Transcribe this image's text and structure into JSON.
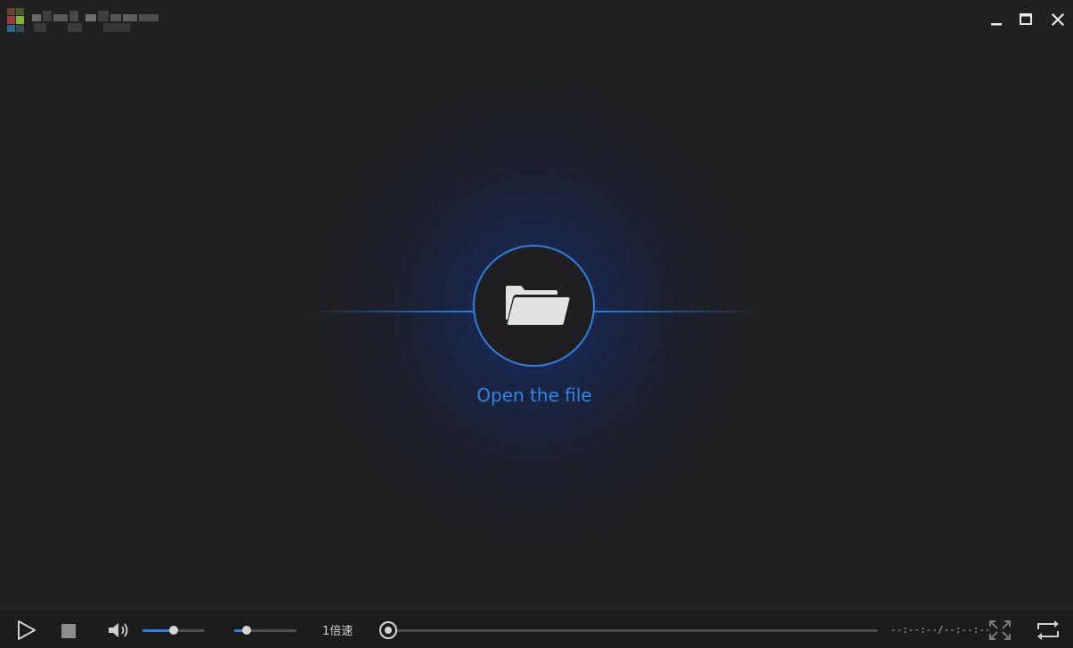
{
  "titlebar": {
    "logo_icon": "app-logo-icon",
    "title_text": "",
    "buttons": [
      {
        "name": "minimize",
        "icon": "minimize-icon"
      },
      {
        "name": "maximize",
        "icon": "maximize-icon"
      },
      {
        "name": "close",
        "icon": "close-icon"
      }
    ]
  },
  "stage": {
    "open_icon": "folder-open-icon",
    "open_label": "Open the file",
    "accent_color": "#2f86e6"
  },
  "controls": {
    "play_icon": "play-icon",
    "stop_icon": "stop-icon",
    "volume_icon": "speaker-volume-icon",
    "volume_level": 0.5,
    "balance_level": 0.2,
    "speed_label": "1倍速",
    "progress_level": 0,
    "time_text": "--:--:--/--:--:--",
    "fullscreen_icon": "fullscreen-icon",
    "loop_icon": "loop-icon"
  }
}
